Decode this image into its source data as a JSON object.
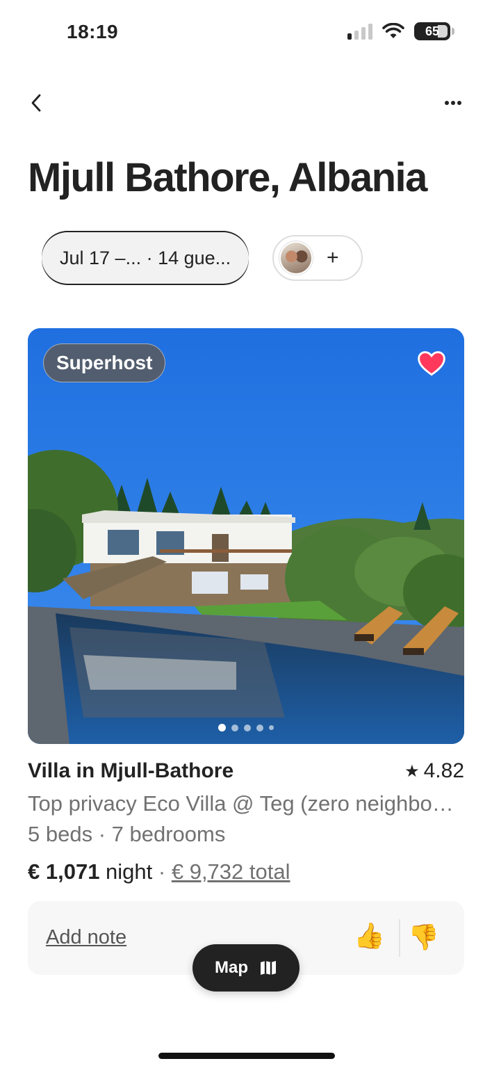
{
  "status_bar": {
    "time": "18:19",
    "battery_level": "65",
    "signal_bars_active": 1,
    "signal_bars_total": 4
  },
  "nav": {
    "back_icon": "chevron-left-icon",
    "more_icon": "ellipsis-icon"
  },
  "page_title": "Mjull Bathore, Albania",
  "filters": {
    "dates_guests": "Jul 17 –... · 14 gue...",
    "add_icon": "+"
  },
  "listing": {
    "badge": "Superhost",
    "favorited": true,
    "photo_count": 5,
    "active_photo": 1,
    "title": "Villa in Mjull-Bathore",
    "rating_star": "★",
    "rating": "4.82",
    "subtitle": "Top privacy Eco Villa @ Teg (zero neighbours)",
    "rooms": "5 beds · 7 bedrooms",
    "price_amount": "€ 1,071",
    "price_unit": " night",
    "price_sep": " · ",
    "price_total": "€ 9,732 total"
  },
  "note_card": {
    "add_note": "Add note",
    "thumb_up": "👍",
    "thumb_down": "👎"
  },
  "map_button": {
    "label": "Map",
    "icon": "map-icon"
  },
  "colors": {
    "text_primary": "#222222",
    "text_secondary": "#717171",
    "heart": "#ff385c",
    "sky": "#2f7be0"
  }
}
